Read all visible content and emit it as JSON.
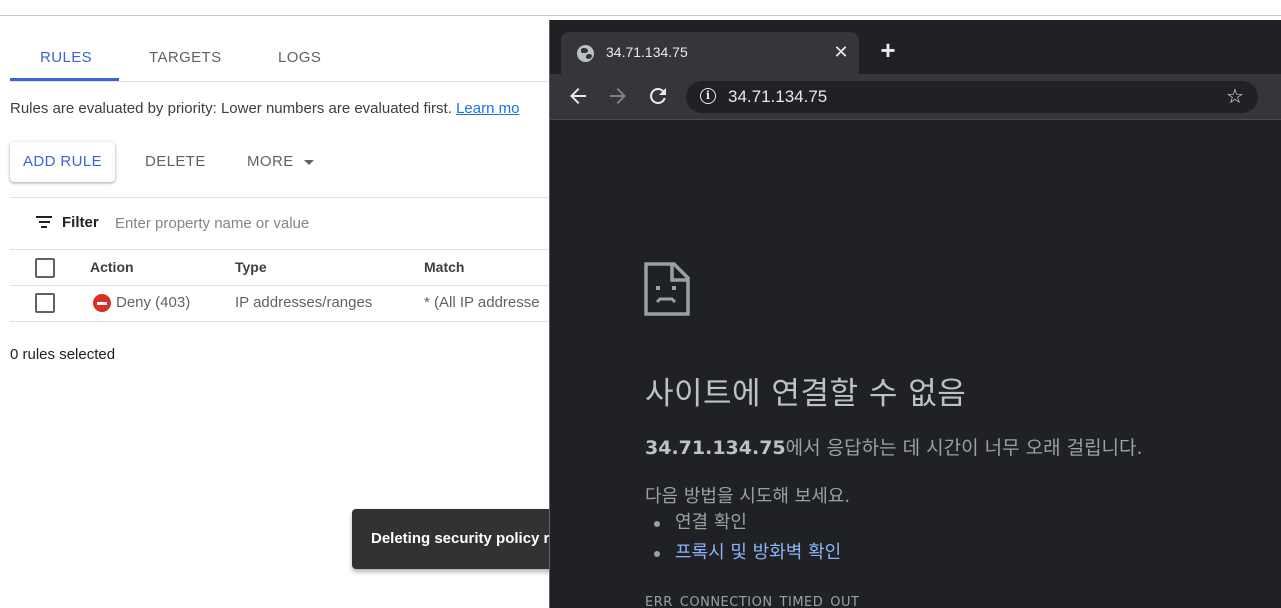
{
  "console": {
    "tabs": [
      {
        "label": "RULES",
        "active": true
      },
      {
        "label": "TARGETS",
        "active": false
      },
      {
        "label": "LOGS",
        "active": false
      }
    ],
    "info_text": "Rules are evaluated by priority: Lower numbers are evaluated first.",
    "learn_more": "Learn mo",
    "toolbar": {
      "add_rule": "ADD RULE",
      "delete": "DELETE",
      "more": "MORE"
    },
    "filter": {
      "label": "Filter",
      "placeholder": "Enter property name or value"
    },
    "table": {
      "headers": [
        "Action",
        "Type",
        "Match"
      ],
      "rows": [
        {
          "action": "Deny (403)",
          "type": "IP addresses/ranges",
          "match": "* (All IP addresse"
        }
      ]
    },
    "selected_count": "0 rules selected",
    "snackbar": "Deleting security policy ru"
  },
  "browser": {
    "tab_title": "34.71.134.75",
    "url": "34.71.134.75",
    "error": {
      "title": "사이트에 연결할 수 없음",
      "host": "34.71.134.75",
      "message_suffix": "에서 응답하는 데 시간이 너무 오래 걸립니다.",
      "try_label": "다음 방법을 시도해 보세요.",
      "suggestions": [
        "연결 확인",
        "프록시 및 방화벽 확인"
      ],
      "code": "ERR_CONNECTION_TIMED_OUT"
    }
  },
  "colors": {
    "accent": "#3f62d6",
    "deny": "#d93025",
    "chrome_bg": "#202124",
    "chrome_toolbar": "#35363a",
    "link_dark": "#8ab4f8"
  },
  "icons": [
    "filter-icon",
    "deny-icon",
    "globe-icon",
    "close-icon",
    "plus-icon",
    "back-arrow-icon",
    "forward-arrow-icon",
    "reload-icon",
    "info-icon",
    "star-icon",
    "sad-document-icon",
    "caret-down-icon"
  ]
}
